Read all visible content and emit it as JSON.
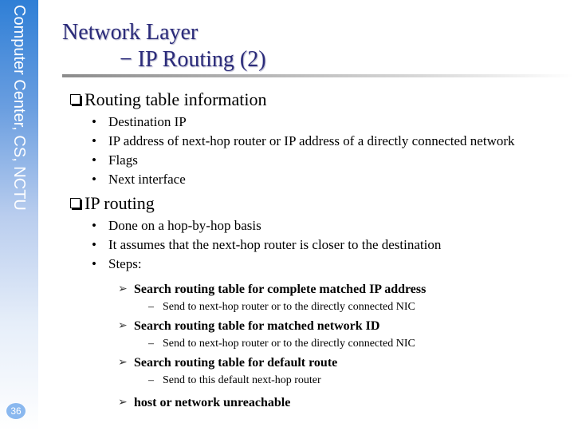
{
  "sidebar": {
    "label": "Computer Center, CS, NCTU",
    "page_number": "36"
  },
  "title": {
    "line1": "Network Layer",
    "line2": "− IP Routing (2)"
  },
  "sections": [
    {
      "heading": "Routing table information",
      "items": [
        "Destination IP",
        "IP address of next-hop router or IP address of a directly connected network",
        "Flags",
        "Next interface"
      ]
    },
    {
      "heading": "IP routing",
      "items": [
        "Done on a hop-by-hop basis",
        "It assumes that the next-hop router is closer to the destination",
        "Steps:"
      ],
      "steps": [
        {
          "label": "Search routing table for complete matched IP address",
          "detail": "Send to next-hop router or to the directly connected NIC"
        },
        {
          "label": "Search routing table for matched network ID",
          "detail": "Send to next-hop router or to the directly connected NIC"
        },
        {
          "label": "Search routing table for default route",
          "detail": "Send to this default next-hop router"
        },
        {
          "label": "host or network unreachable",
          "detail": null
        }
      ]
    }
  ],
  "glyphs": {
    "bullet": "•",
    "arrow": "➢",
    "dash": "–"
  }
}
